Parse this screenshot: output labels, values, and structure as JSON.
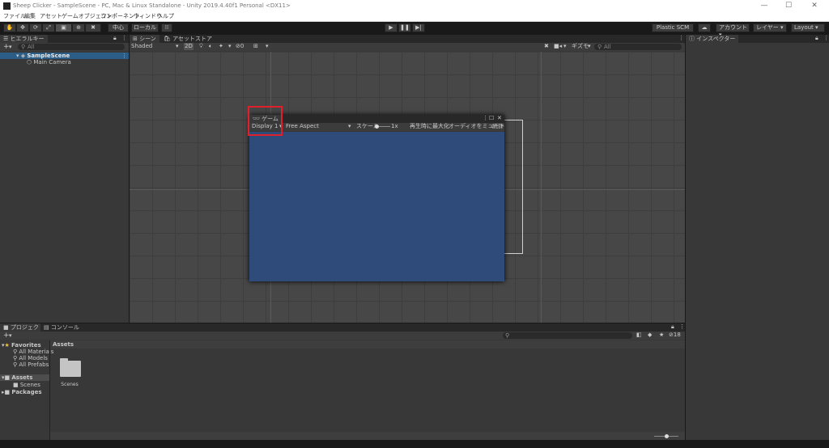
{
  "window": {
    "title": "Sheep Clicker - SampleScene - PC, Mac & Linux Standalone - Unity 2019.4.40f1 Personal <DX11>",
    "min": "—",
    "max": "☐",
    "close": "✕"
  },
  "menu": [
    "ファイル",
    "編集",
    "アセット",
    "ゲームオブジェクト",
    "コンポーネント",
    "ウィンドウ",
    "ヘルプ"
  ],
  "toolbar": {
    "tools": [
      "✋",
      "✥",
      "⟳",
      "⤢",
      "▣",
      "⊕",
      "✖"
    ],
    "pivot": "中心",
    "space": "ローカル",
    "snap": "⁞⁞",
    "play": "▶",
    "pause": "❚❚",
    "step": "▶|",
    "plastic": "Plastic SCM",
    "cloud": "☁",
    "account": "アカウント",
    "layers": "レイヤー",
    "layout": "Layout"
  },
  "hierarchy": {
    "tab": "ヒエラルキー",
    "add": "+",
    "search_placeholder": "All",
    "scene": "SampleScene",
    "items": [
      "Main Camera"
    ]
  },
  "scene_view": {
    "tabs": [
      "シーン",
      "アセットストア"
    ],
    "shading": "Shaded",
    "mode_2d": "2D",
    "hidden_count": "0",
    "gizmos": "ギズモ",
    "search_placeholder": "All"
  },
  "game_view": {
    "tab": "ゲーム",
    "display": "Display 1",
    "aspect": "Free Aspect",
    "scale_label": "スケール",
    "scale_value": "1x",
    "maximize": "再生時に最大化",
    "mute": "オーディオをミュート",
    "stats": "統計情報",
    "viewport_color": "#2e4b7a"
  },
  "inspector": {
    "tab": "インスペクター"
  },
  "project": {
    "tabs": [
      "プロジェクト",
      "コンソール"
    ],
    "add": "+",
    "favorites_label": "Favorites",
    "favorites": [
      "All Materials",
      "All Models",
      "All Prefabs"
    ],
    "assets_label": "Assets",
    "assets_children": [
      "Scenes"
    ],
    "packages_label": "Packages",
    "breadcrumb": "Assets",
    "folders": [
      "Scenes"
    ],
    "hidden_count": "18"
  },
  "colors": {
    "accent": "#2c5d87",
    "highlight": "#e0202a"
  }
}
